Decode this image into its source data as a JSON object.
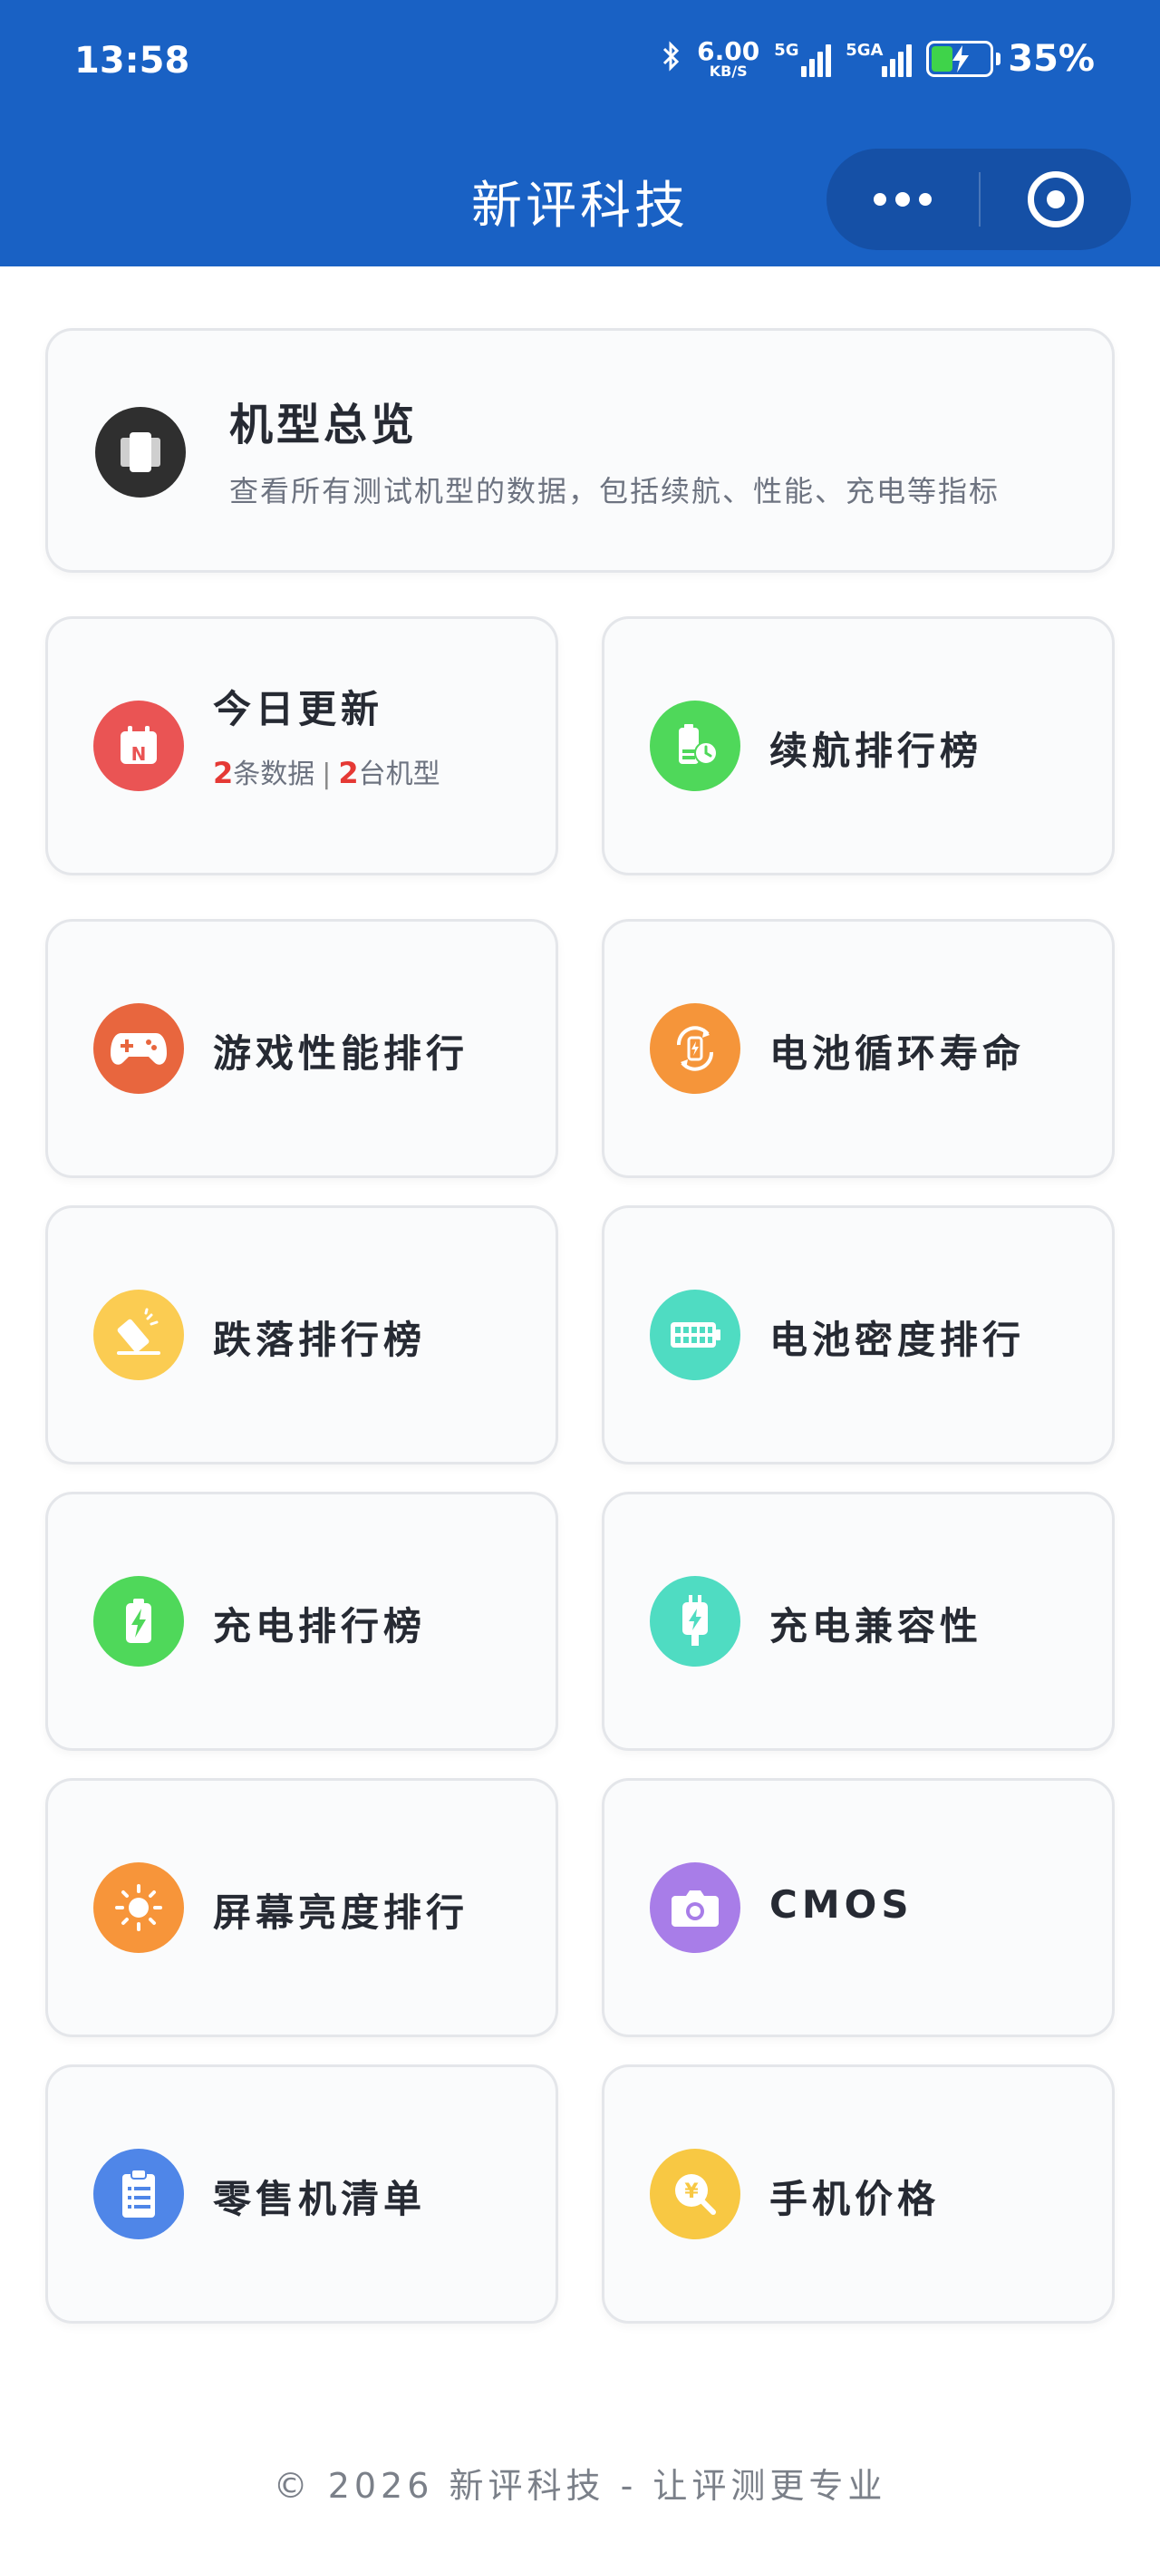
{
  "status_bar": {
    "time": "13:58",
    "net_speed": "6.00",
    "net_unit": "KB/S",
    "sim1_label": "5G",
    "sim2_label": "5GA",
    "battery": "35%"
  },
  "nav": {
    "title": "新评科技"
  },
  "overview": {
    "title": "机型总览",
    "subtitle": "查看所有测试机型的数据，包括续航、性能、充电等指标"
  },
  "today": {
    "title": "今日更新",
    "data_count": "2",
    "data_suffix": "条数据",
    "separator": "|",
    "model_count": "2",
    "model_suffix": "台机型"
  },
  "tiles": {
    "battery_life": "续航排行榜",
    "gaming": "游戏性能排行",
    "battery_cycle": "电池循环寿命",
    "drop": "跌落排行榜",
    "battery_density": "电池密度排行",
    "charging": "充电排行榜",
    "charging_compat": "充电兼容性",
    "brightness": "屏幕亮度排行",
    "cmos": "CMOS",
    "retail": "零售机清单",
    "price": "手机价格"
  },
  "colors": {
    "header": "#1961c4",
    "overview_icon": "#2f2f2f",
    "today_icon": "#ea5454",
    "battery_life_icon": "#4fd85a",
    "gaming_icon": "#e8663e",
    "battery_cycle_icon": "#f5953a",
    "drop_icon": "#fbcc52",
    "battery_density_icon": "#4fdcc2",
    "charging_icon": "#4fd85a",
    "charging_compat_icon": "#4fdcc2",
    "brightness_icon": "#f7953a",
    "cmos_icon": "#a87de8",
    "retail_icon": "#4f86e8",
    "price_icon": "#f8c843",
    "highlight": "#e53935"
  },
  "footer": {
    "text": "© 2026 新评科技 - 让评测更专业"
  }
}
